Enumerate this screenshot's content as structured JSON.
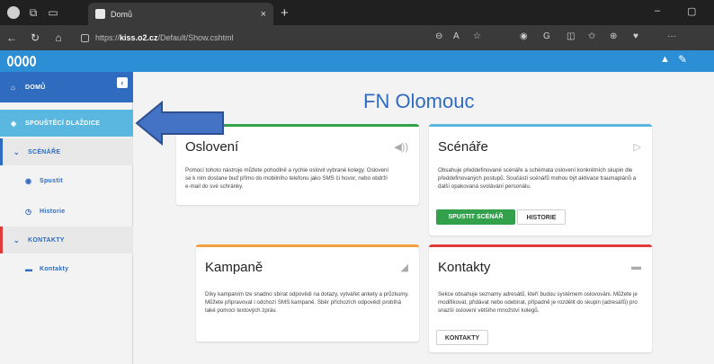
{
  "browser": {
    "tab_title": "Domů",
    "tab_close": "×",
    "new_tab": "+",
    "url_prefix": "https://",
    "url_host": "kiss.o2.cz",
    "url_path": "/Default/Show.cshtml",
    "min": "–",
    "restore": "▢"
  },
  "app": {
    "bell": "🔔",
    "wrench": "🔧"
  },
  "sidebar": {
    "home": "DOMŮ",
    "collapse": "‹",
    "tiles": "SPOUŠTĚCÍ DLAŽDICE",
    "scenarios": "SCÉNÁŘE",
    "run": "Spustit",
    "history": "Historie",
    "contacts": "KONTAKTY",
    "contacts_sub": "Kontakty"
  },
  "page": {
    "title": "FN Olomouc"
  },
  "cards": {
    "osloveni": {
      "title": "Oslovení",
      "text": "Pomocí tohoto nástroje můžete pohodlně a rychle oslovit vybrané kolegy. Oslovení se k nim dostane buď přímo do mobilního telefonu jako SMS či hovor, nebo obdrží e-mail do své schránky."
    },
    "scenare": {
      "title": "Scénáře",
      "text": "Obsahuje předdefinované scénáře a schémata oslovení konkrétních skupin dle předdefinovaných postupů. Součástí scénářů mohou být aktivace traumaplánů a další opakovaná svolávání personálu.",
      "btn_run": "SPUSTIT SCÉNÁŘ",
      "btn_history": "HISTORIE"
    },
    "kampane": {
      "title": "Kampaně",
      "text": "Díky kampaním lze snadno sbírat odpovědi na dotazy, vytvářet ankety a průzkumy. Můžete připravovat i odchozí SMS kampaně. Sběr příchozích odpovědí probíhá také pomocí textových zpráv."
    },
    "kontakty": {
      "title": "Kontakty",
      "text": "Sekce obsahuje seznamy adresátů, kteří budou systémem oslovováni. Můžete je modifikovat, přidávat nebo odebírat, případně je rozdělit do skupin (adresářů) pro snazší oslovení většího množství kolegů.",
      "btn": "KONTAKTY"
    }
  },
  "colors": {
    "accent_blue": "#2f6bbf",
    "app_bar": "#2c8fd6",
    "green": "#33a04b",
    "orange": "#f0a040",
    "red": "#e03a3a",
    "cyan": "#5ab8e0"
  }
}
